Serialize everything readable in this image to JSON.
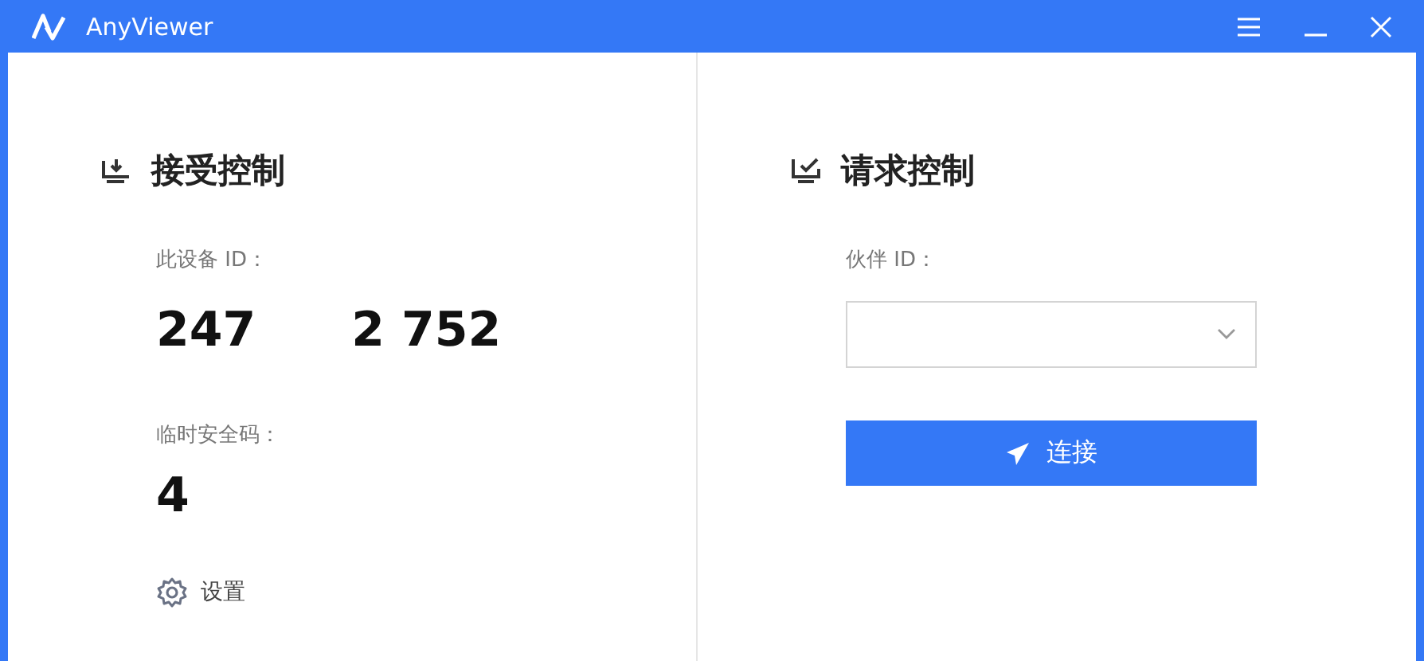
{
  "window": {
    "title": "AnyViewer"
  },
  "receive": {
    "heading": "接受控制",
    "device_id_label": "此设备 ID：",
    "device_id_parts": [
      "247",
      "2 752"
    ],
    "temp_code_label": "临时安全码：",
    "temp_code_parts": [
      "4"
    ],
    "settings": "设置"
  },
  "request": {
    "heading": "请求控制",
    "partner_id_label": "伙伴 ID：",
    "connect_button": "连接"
  }
}
